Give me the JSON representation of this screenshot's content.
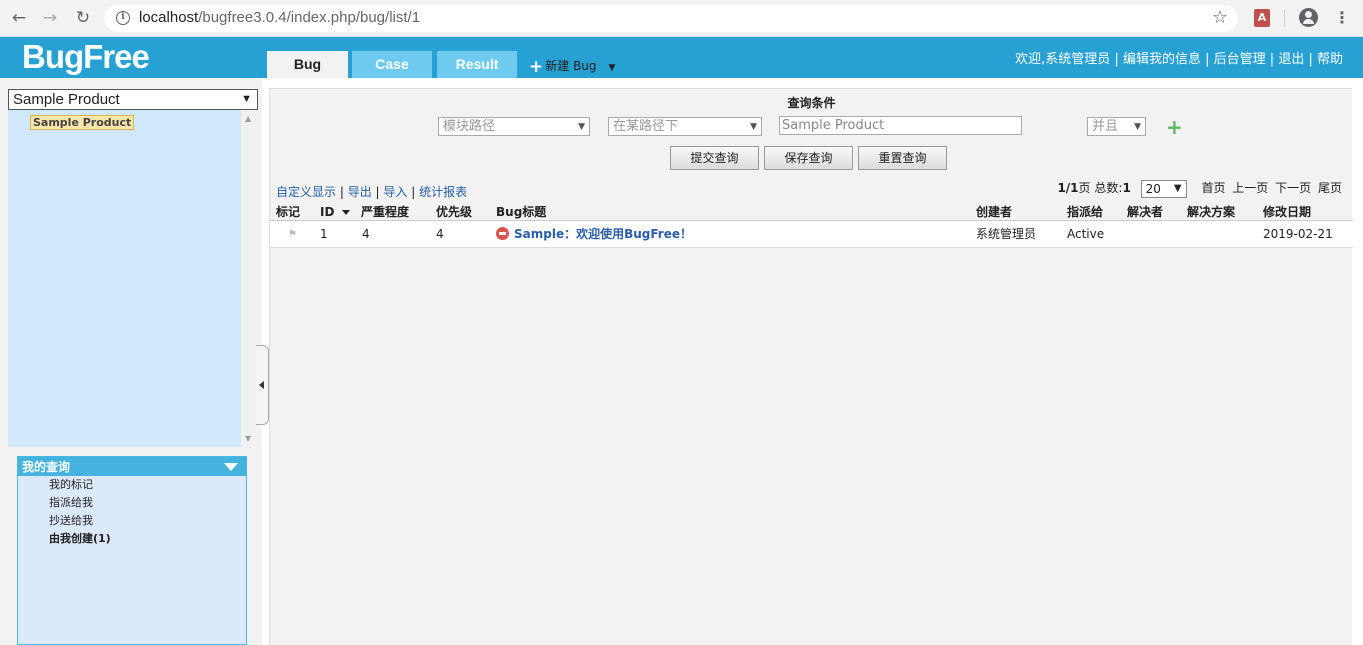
{
  "browser": {
    "url_host": "localhost",
    "url_path": "/bugfree3.0.4/index.php/bug/list/1"
  },
  "header": {
    "logo": "BugFree",
    "tabs": [
      {
        "label": "Bug"
      },
      {
        "label": "Case"
      },
      {
        "label": "Result"
      }
    ],
    "new_bug_label": "新建 Bug",
    "links": {
      "welcome": "欢迎,",
      "user": "系统管理员",
      "edit_profile": "编辑我的信息",
      "admin": "后台管理",
      "logout": "退出",
      "help": "帮助"
    }
  },
  "sidebar": {
    "product_select": "Sample Product",
    "tree_node": "Sample Product",
    "my_queries": {
      "title": "我的查询",
      "items": [
        {
          "label": "我的标记"
        },
        {
          "label": "指派给我"
        },
        {
          "label": "抄送给我"
        },
        {
          "label": "由我创建(1)"
        }
      ]
    }
  },
  "query": {
    "title": "查询条件",
    "field_select": "模块路径",
    "operator_select": "在某路径下",
    "value_input": "Sample Product",
    "logic_select": "并且",
    "buttons": {
      "submit": "提交查询",
      "save": "保存查询",
      "reset": "重置查询"
    }
  },
  "toolbar": {
    "custom_display": "自定义显示",
    "export": "导出",
    "import": "导入",
    "report": "统计报表"
  },
  "pager": {
    "page_info": "1/1",
    "page_suffix": "页",
    "total_label": "总数:",
    "total": "1",
    "page_size": "20",
    "first": "首页",
    "prev": "上一页",
    "next": "下一页",
    "last": "尾页"
  },
  "grid": {
    "columns": {
      "mark": "标记",
      "id": "ID",
      "severity": "严重程度",
      "priority": "优先级",
      "title": "Bug标题",
      "creator": "创建者",
      "assignee": "指派给",
      "resolver": "解决者",
      "resolution": "解决方案",
      "modified": "修改日期"
    },
    "rows": [
      {
        "id": "1",
        "severity": "4",
        "priority": "4",
        "title": "Sample：欢迎使用BugFree！",
        "creator": "系统管理员",
        "assignee": "Active",
        "resolver": "",
        "resolution": "",
        "modified": "2019-02-21"
      }
    ]
  }
}
